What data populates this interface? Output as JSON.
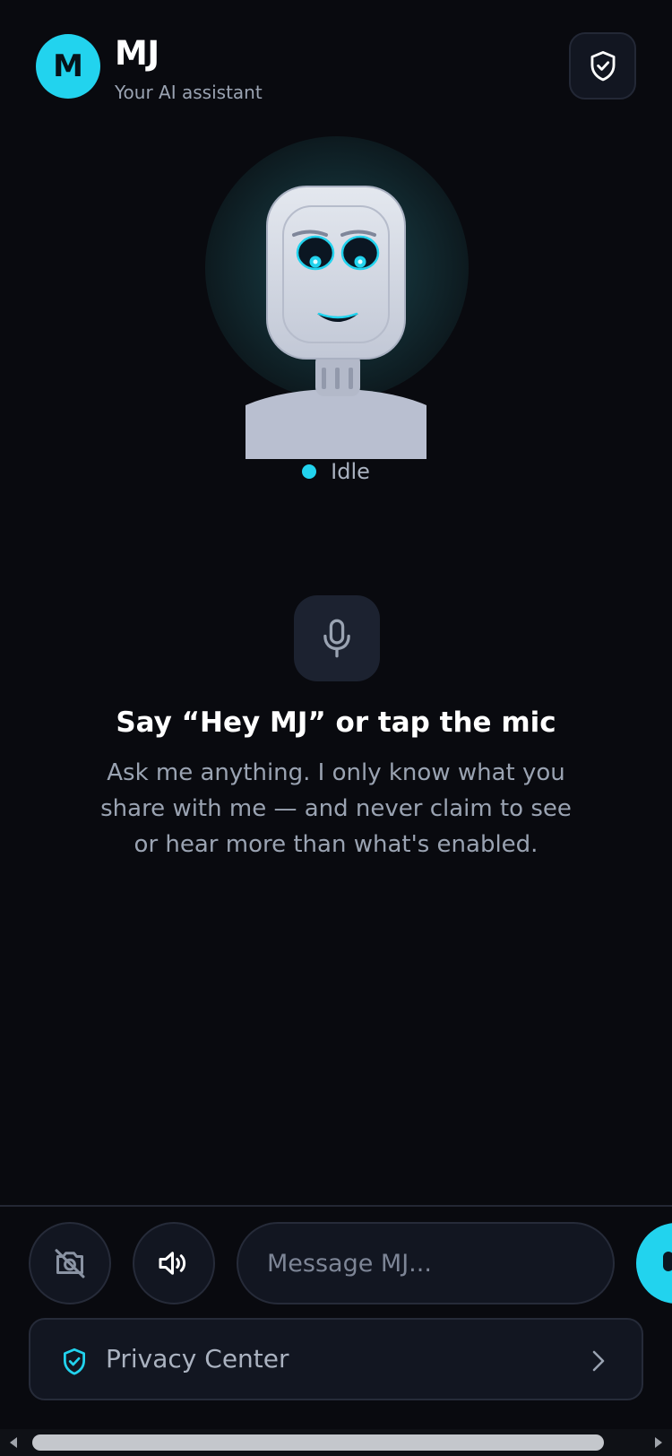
{
  "header": {
    "avatar_letter": "M",
    "title": "MJ",
    "subtitle": "Your AI assistant"
  },
  "assistant": {
    "status_label": "Idle"
  },
  "prompt": {
    "headline": "Say “Hey MJ” or tap the mic",
    "description": "Ask me anything. I only know what you share with me — and never claim to see or hear more than what's enabled."
  },
  "composer": {
    "placeholder": "Message MJ..."
  },
  "privacy": {
    "label": "Privacy Center"
  },
  "icons": {
    "header_button": "shield-check-icon",
    "mic": "microphone-icon",
    "camera": "camera-off-icon",
    "speaker": "speaker-on-icon",
    "privacy": "shield-check-icon",
    "chevron": "chevron-right-icon"
  },
  "colors": {
    "accent": "#22d3ee",
    "background": "#090a0f",
    "surface": "#121621"
  }
}
